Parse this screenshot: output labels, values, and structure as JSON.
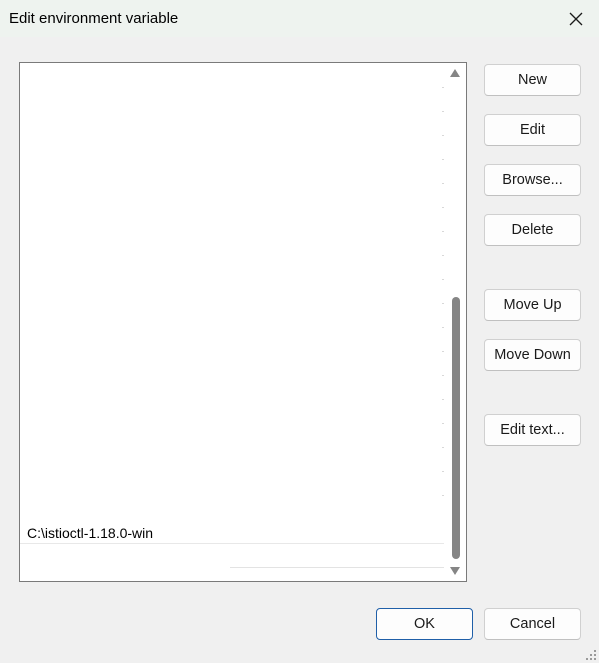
{
  "window": {
    "title": "Edit environment variable"
  },
  "list": {
    "items": [
      "C:\\istioctl-1.18.0-win"
    ]
  },
  "buttons": {
    "new": "New",
    "edit": "Edit",
    "browse": "Browse...",
    "delete": "Delete",
    "move_up": "Move Up",
    "move_down": "Move Down",
    "edit_text": "Edit text...",
    "ok": "OK",
    "cancel": "Cancel"
  },
  "icons": {
    "close": "close-icon",
    "scroll_up": "scroll-up-arrow-icon",
    "scroll_down": "scroll-down-arrow-icon",
    "resize": "resize-grip-icon"
  },
  "colors": {
    "titlebar": "#eef3ef",
    "background": "#f0f0f0",
    "primary_border": "#1f5fa8",
    "scroll_thumb": "#858585"
  }
}
